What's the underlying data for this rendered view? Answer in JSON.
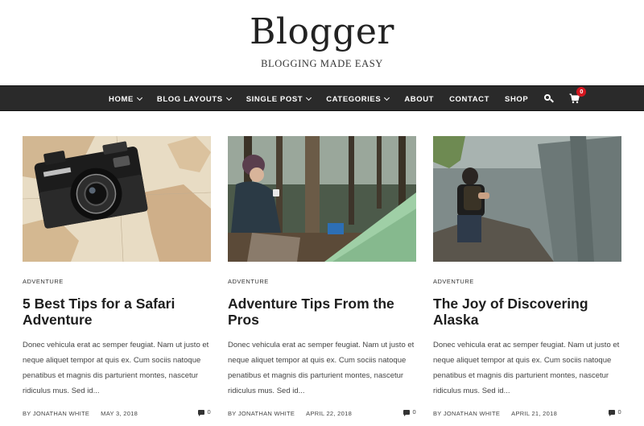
{
  "site": {
    "title": "Blogger",
    "tagline": "BLOGGING MADE EASY"
  },
  "nav": {
    "items": [
      {
        "label": "HOME",
        "dropdown": true
      },
      {
        "label": "BLOG LAYOUTS",
        "dropdown": true
      },
      {
        "label": "SINGLE POST",
        "dropdown": true
      },
      {
        "label": "CATEGORIES",
        "dropdown": true
      },
      {
        "label": "ABOUT",
        "dropdown": false
      },
      {
        "label": "CONTACT",
        "dropdown": false
      },
      {
        "label": "SHOP",
        "dropdown": false
      }
    ],
    "search_icon": "search-icon",
    "cart_icon": "shopping-cart-icon",
    "cart_count": "0"
  },
  "posts": [
    {
      "category": "ADVENTURE",
      "title": "5 Best Tips for a Safari Adventure",
      "excerpt": "Donec vehicula erat ac semper feugiat. Nam ut justo et neque aliquet tempor at quis ex. Cum sociis natoque penatibus et magnis dis parturient montes, nascetur ridiculus mus. Sed id...",
      "author": "BY JONATHAN WHITE",
      "date": "MAY 3, 2018",
      "comments": "0",
      "image": "camera-on-map-photo"
    },
    {
      "category": "ADVENTURE",
      "title": "Adventure Tips From the Pros",
      "excerpt": "Donec vehicula erat ac semper feugiat. Nam ut justo et neque aliquet tempor at quis ex. Cum sociis natoque penatibus et magnis dis parturient montes, nascetur ridiculus mus. Sed id...",
      "author": "BY JONATHAN WHITE",
      "date": "APRIL 22, 2018",
      "comments": "0",
      "image": "camping-tent-forest-photo"
    },
    {
      "category": "ADVENTURE",
      "title": "The Joy of Discovering Alaska",
      "excerpt": "Donec vehicula erat ac semper feugiat. Nam ut justo et neque aliquet tempor at quis ex. Cum sociis natoque penatibus et magnis dis parturient montes, nascetur ridiculus mus. Sed id...",
      "author": "BY JONATHAN WHITE",
      "date": "APRIL 21, 2018",
      "comments": "0",
      "image": "hiker-cliff-photo"
    }
  ],
  "colors": {
    "nav_bg": "#2a2a2a",
    "badge": "#d4161f"
  }
}
